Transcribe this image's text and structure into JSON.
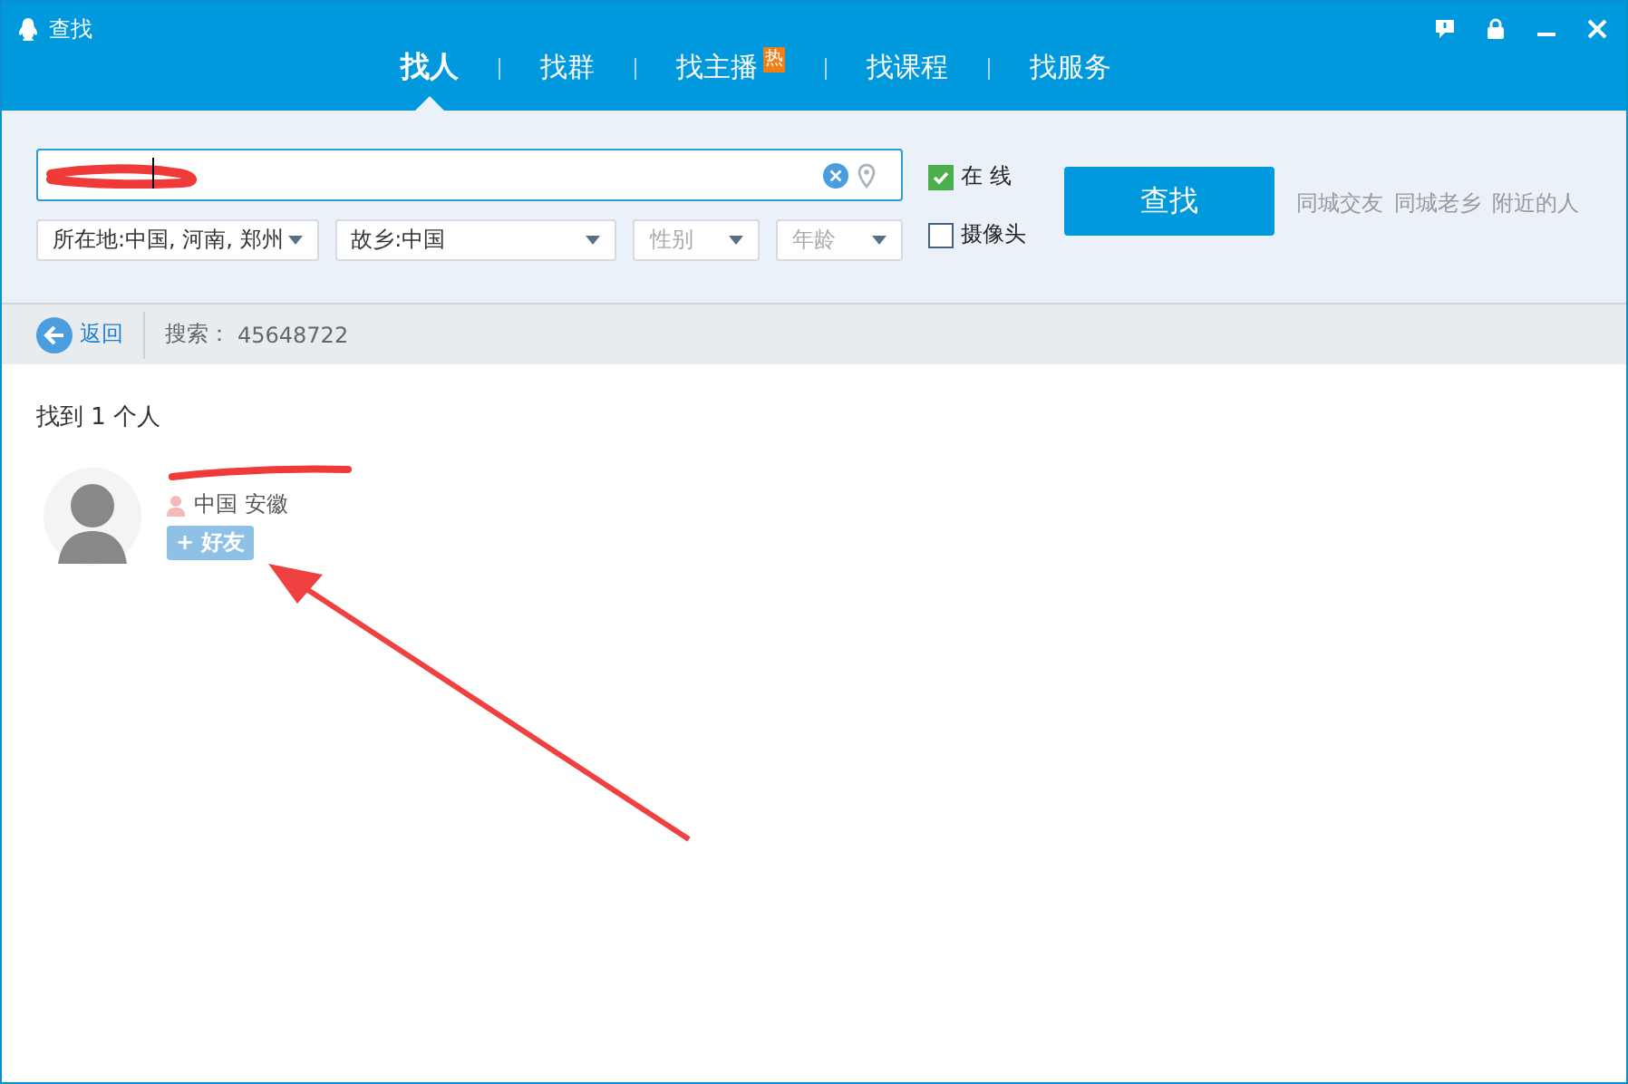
{
  "window": {
    "title": "查找"
  },
  "tabs": [
    {
      "label": "找人",
      "selected": true
    },
    {
      "label": "找群",
      "selected": false
    },
    {
      "label": "找主播",
      "selected": false,
      "badge": "热"
    },
    {
      "label": "找课程",
      "selected": false
    },
    {
      "label": "找服务",
      "selected": false
    }
  ],
  "search": {
    "filters": [
      {
        "text": "所在地:中国, 河南, 郑州",
        "muted": false
      },
      {
        "text": "故乡:中国",
        "muted": false
      },
      {
        "text": "性别",
        "muted": true
      },
      {
        "text": "年龄",
        "muted": true
      }
    ],
    "options": [
      {
        "label": "在 线",
        "checked": true
      },
      {
        "label": "摄像头",
        "checked": false
      }
    ],
    "button": "查找",
    "links": [
      "同城交友",
      "同城老乡",
      "附近的人"
    ]
  },
  "toolbar": {
    "back": "返回",
    "query_label": "搜索：",
    "query": "45648722"
  },
  "results": {
    "summary": "找到 1 个人",
    "people": [
      {
        "location": "中国 安徽",
        "add_button": "+ 好友"
      }
    ]
  }
}
